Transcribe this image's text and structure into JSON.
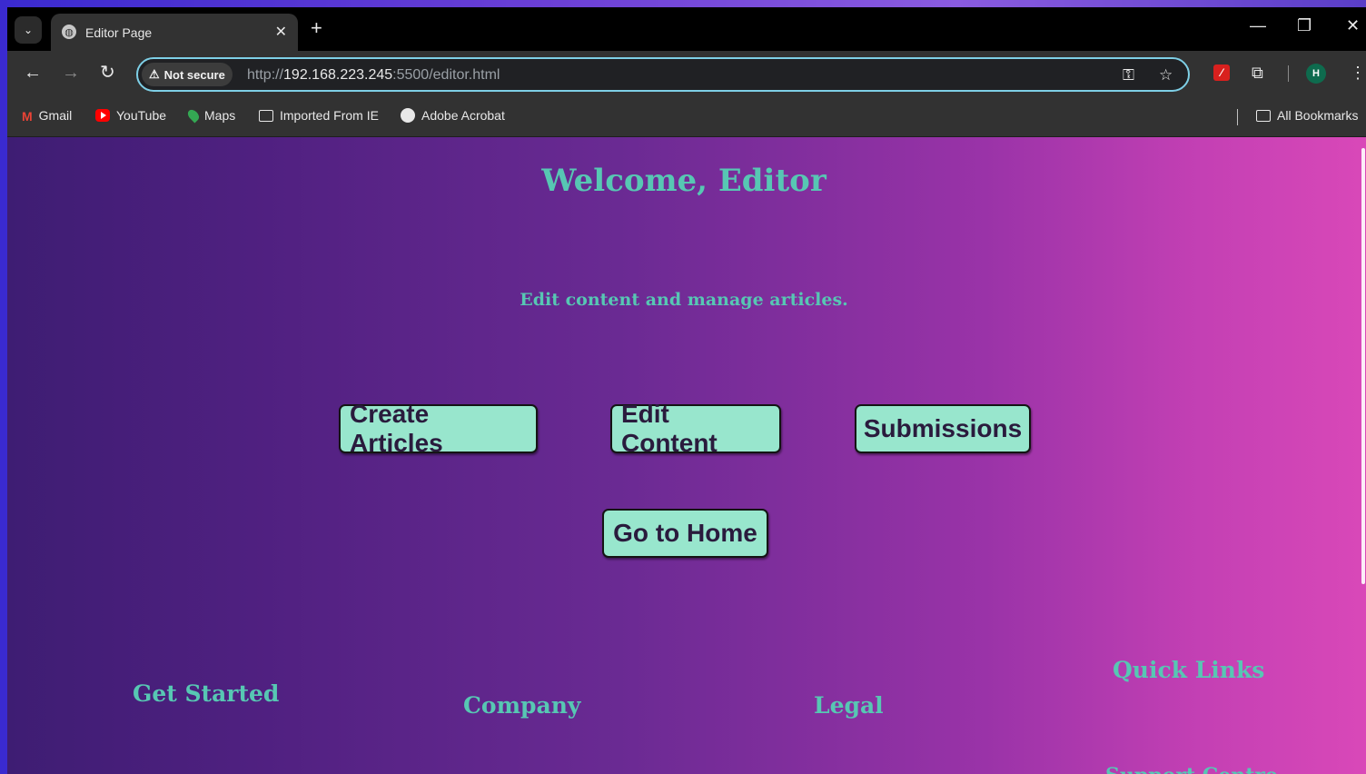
{
  "browser": {
    "tab_title": "Editor Page",
    "security_label": "Not secure",
    "url_scheme": "http://",
    "url_host": "192.168.223.245",
    "url_rest": ":5500/editor.html",
    "avatar_letter": "H",
    "bookmarks": [
      {
        "label": "Gmail",
        "icon": "gmail-icon"
      },
      {
        "label": "YouTube",
        "icon": "youtube-icon"
      },
      {
        "label": "Maps",
        "icon": "maps-icon"
      },
      {
        "label": "Imported From IE",
        "icon": "folder-icon"
      },
      {
        "label": "Adobe Acrobat",
        "icon": "globe-icon"
      }
    ],
    "all_bookmarks_label": "All Bookmarks"
  },
  "page": {
    "title": "Welcome, Editor",
    "subtitle": "Edit content and manage articles.",
    "buttons": {
      "create": "Create Articles",
      "edit": "Edit Content",
      "submissions": "Submissions",
      "home": "Go to Home"
    },
    "footer": {
      "get_started": "Get Started",
      "company": "Company",
      "legal": "Legal",
      "quick_links": "Quick Links",
      "support": "Support Centre"
    }
  },
  "colors": {
    "accent_text": "#57c7b3",
    "button_bg": "#98e6cd",
    "omnibox_border": "#7ecfe6"
  }
}
